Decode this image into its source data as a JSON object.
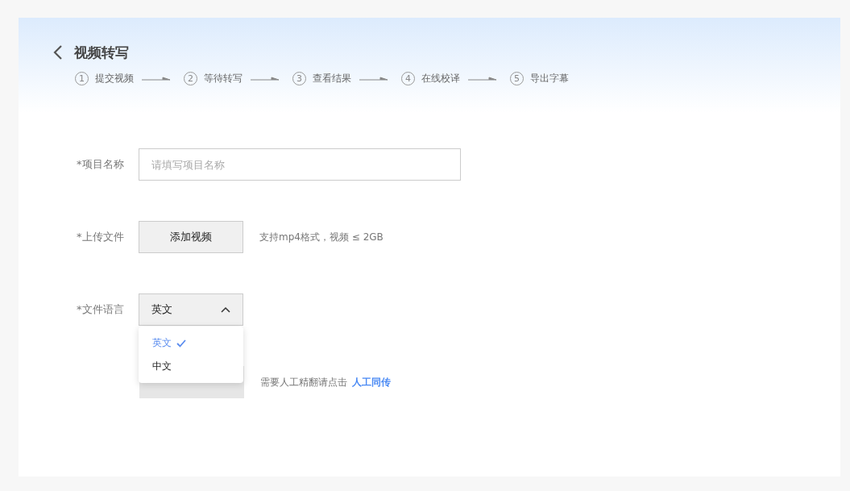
{
  "header": {
    "title": "视频转写"
  },
  "steps": [
    {
      "number": "1",
      "label": "提交视频"
    },
    {
      "number": "2",
      "label": "等待转写"
    },
    {
      "number": "3",
      "label": "查看结果"
    },
    {
      "number": "4",
      "label": "在线校译"
    },
    {
      "number": "5",
      "label": "导出字幕"
    }
  ],
  "form": {
    "project_name": {
      "label": "*项目名称",
      "placeholder": "请填写项目名称"
    },
    "upload": {
      "label": "*上传文件",
      "button": "添加视频",
      "hint": "支持mp4格式，视频 ≤ 2GB"
    },
    "language": {
      "label": "*文件语言",
      "value": "英文",
      "expanded": true,
      "options": [
        {
          "label": "英文",
          "selected": true
        },
        {
          "label": "中文",
          "selected": false
        }
      ]
    },
    "submit": {
      "disabled": true,
      "hint": "需要人工精翻请点击",
      "link": "人工同传"
    }
  }
}
